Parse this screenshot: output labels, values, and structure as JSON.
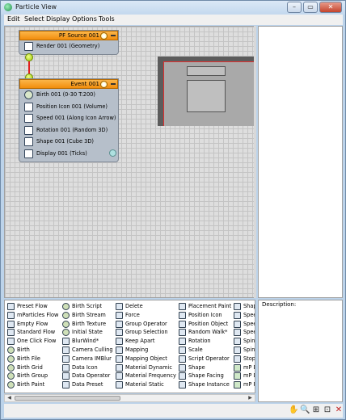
{
  "window": {
    "title": "Particle View"
  },
  "menu": [
    "Edit",
    "Select",
    "Display",
    "Options",
    "Tools"
  ],
  "pf_source": {
    "title": "PF Source 001",
    "operators": [
      {
        "label": "Render 001 (Geometry)",
        "icon": "render-icon"
      }
    ]
  },
  "event": {
    "title": "Event 001",
    "operators": [
      {
        "label": "Birth 001 (0-30 T:200)",
        "icon": "birth-icon"
      },
      {
        "label": "Position Icon 001 (Volume)",
        "icon": "position-icon"
      },
      {
        "label": "Speed 001 (Along Icon Arrow)",
        "icon": "speed-icon"
      },
      {
        "label": "Rotation 001 (Random 3D)",
        "icon": "rotation-icon"
      },
      {
        "label": "Shape 001 (Cube 3D)",
        "icon": "shape-icon"
      },
      {
        "label": "Display 001 (Ticks)",
        "icon": "display-icon"
      }
    ]
  },
  "depot": {
    "columns": [
      [
        "Preset Flow",
        "mParticles Flow",
        "Empty Flow",
        "Standard Flow",
        "One Click Flow",
        "Birth",
        "Birth File",
        "Birth Grid",
        "Birth Group",
        "Birth Paint"
      ],
      [
        "Birth Script",
        "Birth Stream",
        "Birth Texture",
        "Initial State",
        "BlurWind*",
        "Camera Culling",
        "Camera IMBlur",
        "Data Icon",
        "Data Operator",
        "Data Preset"
      ],
      [
        "Delete",
        "Force",
        "Group Operator",
        "Group Selection",
        "Keep Apart",
        "Mapping",
        "Mapping Object",
        "Material Dynamic",
        "Material Frequency",
        "Material Static"
      ],
      [
        "Placement Paint",
        "Position Icon",
        "Position Object",
        "Random Walk*",
        "Rotation",
        "Scale",
        "Script Operator",
        "Shape",
        "Shape Facing",
        "Shape Instance"
      ],
      [
        "Shap",
        "Spee",
        "Spee",
        "Spee",
        "Spin",
        "Spin",
        "Stop",
        "mP E",
        "mP D",
        "mP F"
      ]
    ]
  },
  "description": {
    "label": "Description:"
  },
  "window_buttons": {
    "minimize": "–",
    "restore": "▭",
    "close": "✕"
  }
}
